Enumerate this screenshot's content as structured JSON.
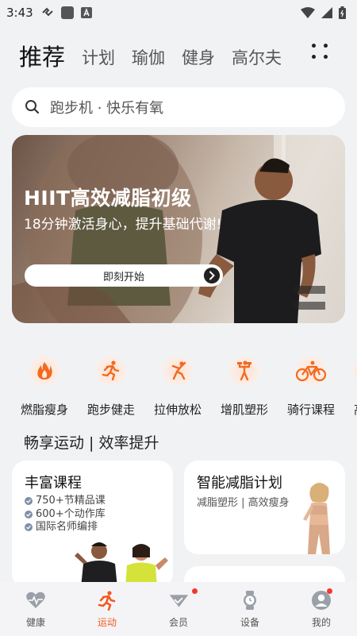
{
  "status_bar": {
    "time": "3:43"
  },
  "top_tabs": [
    {
      "label": "推荐",
      "active": true
    },
    {
      "label": "计划",
      "active": false
    },
    {
      "label": "瑜伽",
      "active": false
    },
    {
      "label": "健身",
      "active": false
    },
    {
      "label": "高尔夫",
      "active": false
    }
  ],
  "search": {
    "text": "跑步机 · 快乐有氧"
  },
  "banner": {
    "title": "HIIT高效减脂初级",
    "subtitle": "18分钟激活身心，提升基础代谢!",
    "cta": "即刻开始"
  },
  "categories": [
    {
      "label": "燃脂瘦身",
      "icon": "flame-icon"
    },
    {
      "label": "跑步健走",
      "icon": "runner-icon"
    },
    {
      "label": "拉伸放松",
      "icon": "stretch-icon"
    },
    {
      "label": "增肌塑形",
      "icon": "strength-icon"
    },
    {
      "label": "骑行课程",
      "icon": "bike-icon"
    },
    {
      "label": "高",
      "icon": "more-category-icon"
    }
  ],
  "section": {
    "title": "畅享运动 | 效率提升"
  },
  "cards": {
    "courses": {
      "title": "丰富课程",
      "features": [
        "750+节精品课",
        "600+个动作库",
        "国际名师编排"
      ]
    },
    "plan": {
      "title": "智能减脂计划",
      "subtitle": "减脂塑形 | 高效瘦身"
    },
    "third": {
      "title": ""
    }
  },
  "bottom_nav": [
    {
      "label": "健康",
      "icon": "heart-pulse-icon",
      "active": false,
      "badge": false
    },
    {
      "label": "运动",
      "icon": "runner-icon",
      "active": true,
      "badge": false
    },
    {
      "label": "会员",
      "icon": "vip-icon",
      "active": false,
      "badge": true
    },
    {
      "label": "设备",
      "icon": "watch-icon",
      "active": false,
      "badge": false
    },
    {
      "label": "我的",
      "icon": "profile-icon",
      "active": false,
      "badge": true
    }
  ],
  "colors": {
    "accent": "#f15a22",
    "background": "#f1f2f4",
    "badge": "#ef3b2d"
  }
}
